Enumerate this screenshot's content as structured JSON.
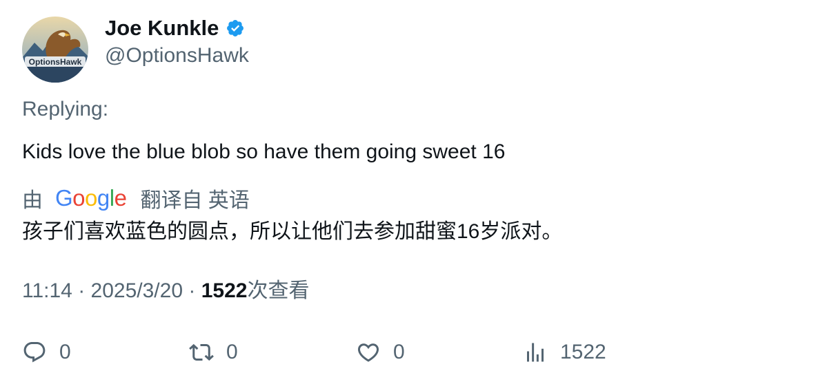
{
  "author": {
    "name": "Joe Kunkle",
    "handle": "@OptionsHawk",
    "avatar_text": "OptionsHawk",
    "verified_color": "#1d9bf0"
  },
  "reply": {
    "label": "Replying:"
  },
  "tweet": {
    "text": "Kids love the blue blob so have them going sweet 16"
  },
  "translation": {
    "prefix": "由",
    "provider": "Google",
    "suffix": "翻译自 英语",
    "text": "孩子们喜欢蓝色的圆点，所以让他们去参加甜蜜16岁派对。"
  },
  "meta": {
    "time": "11:14",
    "sep1": "·",
    "date": "2025/3/20",
    "sep2": "·",
    "views_count": "1522",
    "views_label": "次查看"
  },
  "actions": {
    "reply_count": "0",
    "retweet_count": "0",
    "like_count": "0",
    "views_count": "1522"
  },
  "colors": {
    "text_primary": "#0f1419",
    "text_secondary": "#536471",
    "verified": "#1d9bf0",
    "google_blue": "#4285F4",
    "google_red": "#EA4335",
    "google_yellow": "#FBBC05",
    "google_green": "#34A853"
  },
  "icons": [
    "verified-badge-icon",
    "reply-icon",
    "retweet-icon",
    "like-icon",
    "views-icon"
  ]
}
